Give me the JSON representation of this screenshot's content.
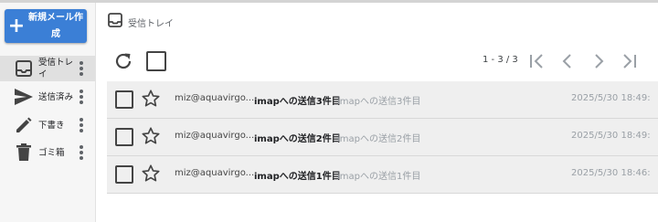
{
  "sidebar": {
    "compose_label": "新規メール作成",
    "items": [
      {
        "label": "受信トレイ",
        "icon": "inbox-icon",
        "active": true
      },
      {
        "label": "送信済み",
        "icon": "send-icon",
        "active": false
      },
      {
        "label": "下書き",
        "icon": "pencil-icon",
        "active": false
      },
      {
        "label": "ゴミ箱",
        "icon": "trash-icon",
        "active": false
      }
    ]
  },
  "header": {
    "breadcrumb": "受信トレイ",
    "breadcrumb_icon": "inbox-icon"
  },
  "toolbar": {
    "pager_text": "1 - 3 / 3"
  },
  "messages": [
    {
      "sender": "miz@aquavirgo...",
      "subject": "imapへの送信3件目",
      "snippet": "imapへの送信3件目",
      "date": "2025/5/30 18:49:"
    },
    {
      "sender": "miz@aquavirgo...",
      "subject": "imapへの送信2件目",
      "snippet": "imapへの送信2件目",
      "date": "2025/5/30 18:49:"
    },
    {
      "sender": "miz@aquavirgo...",
      "subject": "imapへの送信1件目",
      "snippet": "imapへの送信1件目",
      "date": "2025/5/30 18:46:"
    }
  ],
  "colors": {
    "accent": "#3b7fd6",
    "row_bg": "#efefef",
    "sidebar_bg": "#f6f6f6"
  }
}
